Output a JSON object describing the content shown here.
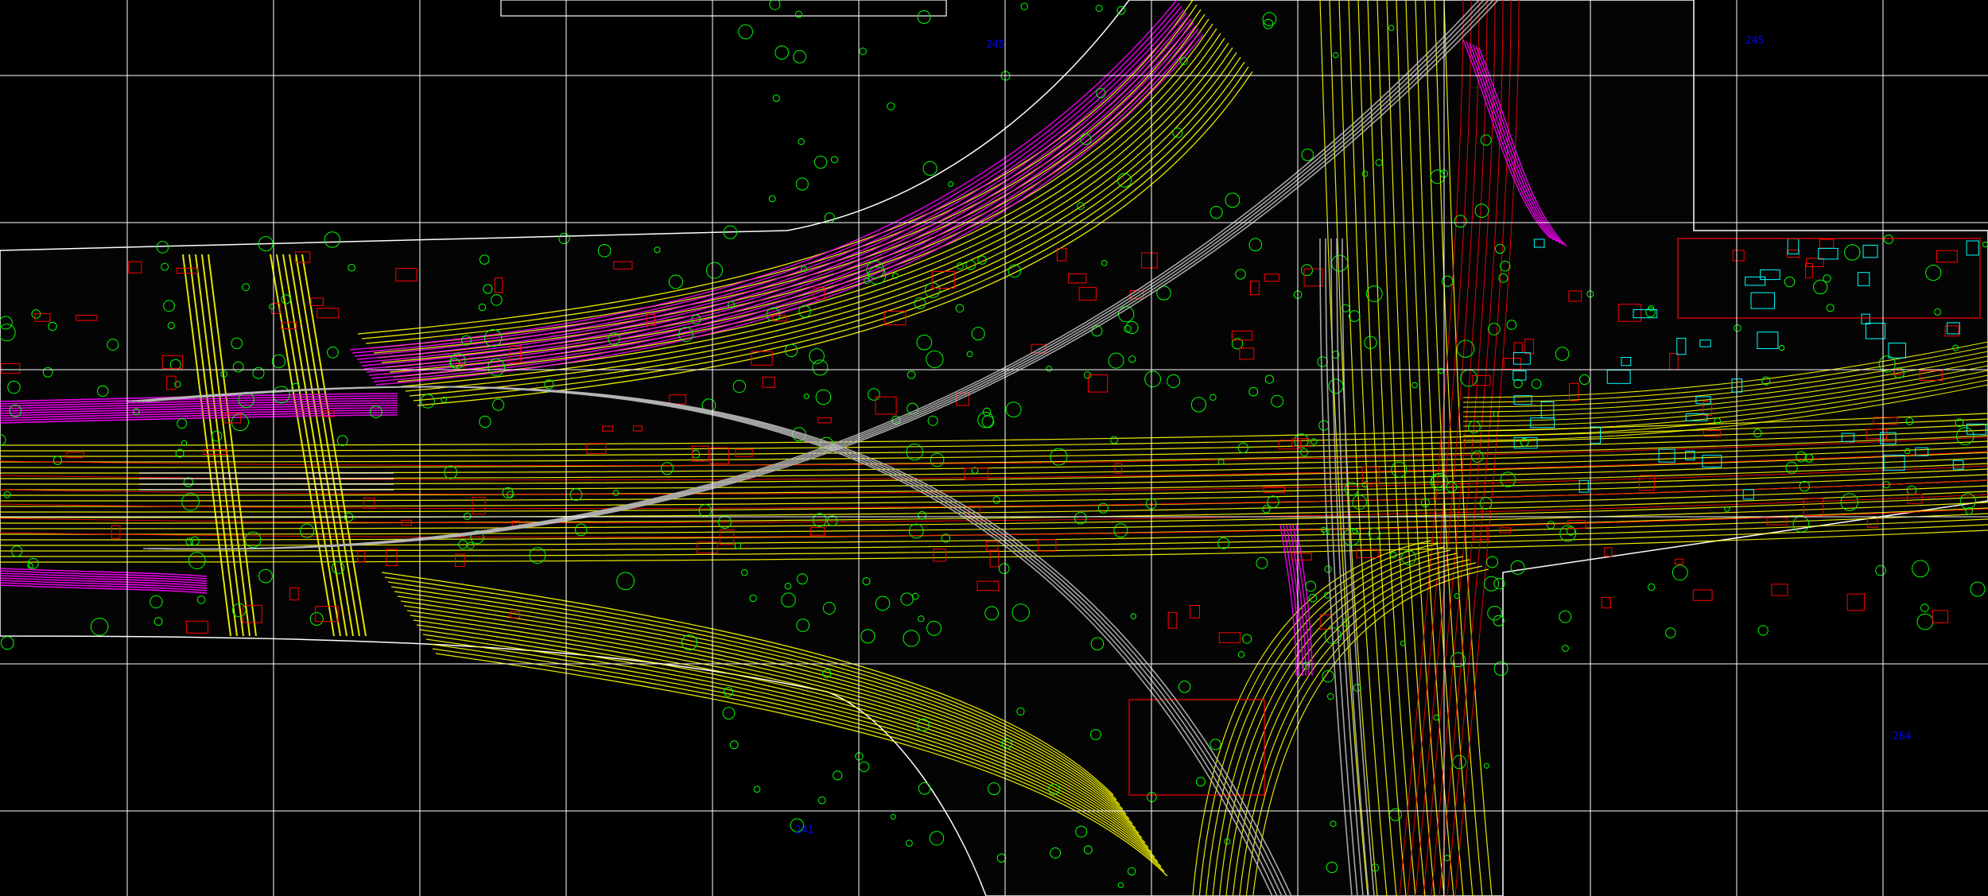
{
  "drawing": {
    "sheet_labels": [
      "245",
      "245",
      "241",
      "264"
    ],
    "colors": {
      "background": "#000000",
      "grid": "#ffffff",
      "boundary": "#ffffff",
      "road": "#ffff00",
      "contour": "#ff00ff",
      "vegetation": "#00ff00",
      "structure": "#ff0000",
      "ramp": "#b8b8b8",
      "water": "#00ffff",
      "label": "#0000ff"
    }
  }
}
